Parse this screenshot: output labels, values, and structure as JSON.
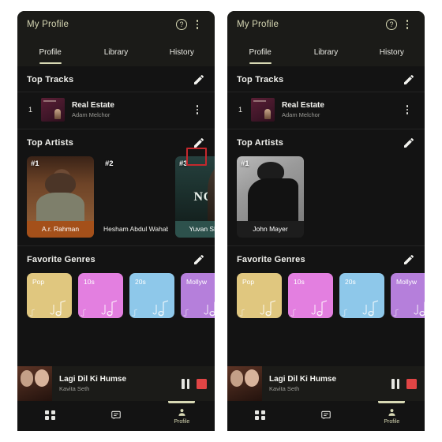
{
  "app": {
    "title": "My Profile",
    "help_icon": "help-circle-icon",
    "menu_icon": "kebab-menu-icon"
  },
  "tabs": [
    {
      "label": "Profile",
      "active": true
    },
    {
      "label": "Library",
      "active": false
    },
    {
      "label": "History",
      "active": false
    }
  ],
  "sections": {
    "top_tracks": {
      "title": "Top Tracks",
      "edit_icon": "pencil-icon"
    },
    "top_artists": {
      "title": "Top Artists",
      "edit_icon": "pencil-icon"
    },
    "favorite_genres": {
      "title": "Favorite Genres",
      "edit_icon": "pencil-icon"
    }
  },
  "tracks": [
    {
      "rank": "1",
      "title": "Real Estate",
      "artist": "Adam Melchor",
      "menu_icon": "kebab-menu-icon"
    }
  ],
  "artists_before": [
    {
      "badge": "#1",
      "name": "A.r. Rahman",
      "art": "art-rahman"
    },
    {
      "badge": "#2",
      "name": "Hesham Abdul Wahab",
      "art": "empty"
    },
    {
      "badge": "#3",
      "name": "Yuvan Shank",
      "art": "art-ngk"
    }
  ],
  "artists_after": [
    {
      "badge": "#1",
      "name": "John Mayer",
      "art": "art-mayer"
    }
  ],
  "genres": [
    {
      "label": "Pop",
      "color": "#e0c77f"
    },
    {
      "label": "10s",
      "color": "#e37fe0"
    },
    {
      "label": "20s",
      "color": "#8ec8ea"
    },
    {
      "label": "Mollyw",
      "color": "#b57fdb"
    }
  ],
  "player": {
    "title": "Lagi Dil Ki Humse",
    "artist": "Kavita Seth",
    "pause_icon": "pause-icon",
    "stop_icon": "stop-icon"
  },
  "bottom_nav": [
    {
      "label": "",
      "icon": "grid-icon",
      "active": false
    },
    {
      "label": "",
      "icon": "chat-icon",
      "active": false
    },
    {
      "label": "Profile",
      "icon": "person-icon",
      "active": true
    }
  ],
  "annotation": {
    "color": "#c4282d",
    "target": "top-artists-edit-button"
  },
  "colors": {
    "accent": "#d7d8b4",
    "surface": "#1b1b18",
    "background": "#131313",
    "stop_red": "#e04545",
    "highlight_red": "#c4282d"
  }
}
